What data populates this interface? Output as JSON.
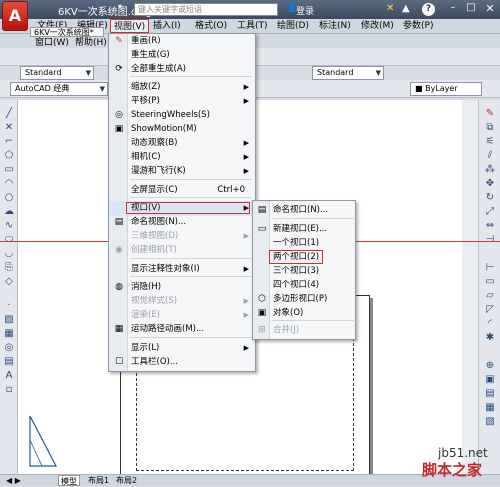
{
  "title_bar": {
    "app_icon": "A",
    "file_name": "6KV一次系统图.dwg",
    "search_placeholder": "键入关键字或短语",
    "login": "登录",
    "min": "–",
    "max": "□",
    "close": "✕",
    "help": "?"
  },
  "menu_bar": {
    "items": [
      "文件(F)",
      "编辑(E)",
      "视图(V)",
      "插入(I)",
      "格式(O)",
      "工具(T)",
      "绘图(D)",
      "标注(N)",
      "修改(M)",
      "参数(P)"
    ]
  },
  "second_row": {
    "tab_label": "6KV一次系统图*",
    "window_menu": "窗口(W)",
    "help_menu": "帮助(H)"
  },
  "toolbar": {
    "text_style": "Standard",
    "dim_style": "Standard",
    "workspace": "AutoCAD 经典",
    "layer_linetype": "ByLayer"
  },
  "view_menu": {
    "items": [
      {
        "label": "重画(R)",
        "icon": "pencil-icon",
        "glyph": "✎"
      },
      {
        "label": "重生成(G)",
        "icon": "",
        "glyph": ""
      },
      {
        "label": "全部重生成(A)",
        "icon": "regen-icon",
        "glyph": "⟳"
      },
      {
        "label": "缩放(Z)",
        "submenu": true
      },
      {
        "label": "平移(P)",
        "submenu": true
      },
      {
        "label": "SteeringWheels(S)",
        "icon": "wheel-icon",
        "glyph": "◎"
      },
      {
        "label": "ShowMotion(M)",
        "icon": "showmotion-icon",
        "glyph": "▣"
      },
      {
        "label": "动态观察(B)",
        "submenu": true
      },
      {
        "label": "相机(C)",
        "submenu": true
      },
      {
        "label": "漫游和飞行(K)",
        "submenu": true
      },
      {
        "label": "全屏显示(C)",
        "shortcut": "Ctrl+0"
      },
      {
        "label": "视口(V)",
        "submenu": true,
        "highlighted": true
      },
      {
        "label": "命名视图(N)...",
        "icon": "named-view-icon",
        "glyph": "▤"
      },
      {
        "label": "三维视图(D)",
        "submenu": true,
        "disabled": true
      },
      {
        "label": "创建相机(T)",
        "icon": "camera-icon",
        "glyph": "◉",
        "disabled": true
      },
      {
        "label": "显示注释性对象(I)",
        "submenu": true
      },
      {
        "label": "消隐(H)",
        "icon": "hide-icon",
        "glyph": "◍"
      },
      {
        "label": "视觉样式(S)",
        "submenu": true,
        "disabled": true
      },
      {
        "label": "渲染(E)",
        "submenu": true,
        "disabled": true
      },
      {
        "label": "运动路径动画(M)...",
        "icon": "motion-path-icon",
        "glyph": "▦"
      },
      {
        "label": "显示(L)",
        "submenu": true
      },
      {
        "label": "工具栏(O)...",
        "icon": "",
        "glyph": "☐"
      }
    ]
  },
  "viewports_menu": {
    "items": [
      {
        "label": "命名视口(N)...",
        "glyph": "▤"
      },
      {
        "label": "新建视口(E)...",
        "glyph": "▭"
      },
      {
        "label": "一个视口(1)",
        "glyph": ""
      },
      {
        "label": "两个视口(2)",
        "glyph": "",
        "highlighted": true
      },
      {
        "label": "三个视口(3)",
        "glyph": ""
      },
      {
        "label": "四个视口(4)",
        "glyph": ""
      },
      {
        "label": "多边形视口(P)",
        "glyph": "⬡"
      },
      {
        "label": "对象(O)",
        "glyph": "▣"
      },
      {
        "label": "合并(J)",
        "glyph": "⊞",
        "disabled": true
      }
    ]
  },
  "bottom_tabs": {
    "model": "模型",
    "layout1": "布局1",
    "layout2": "布局2"
  },
  "watermark": {
    "site": "jb51.net",
    "brand": "脚本之家"
  }
}
